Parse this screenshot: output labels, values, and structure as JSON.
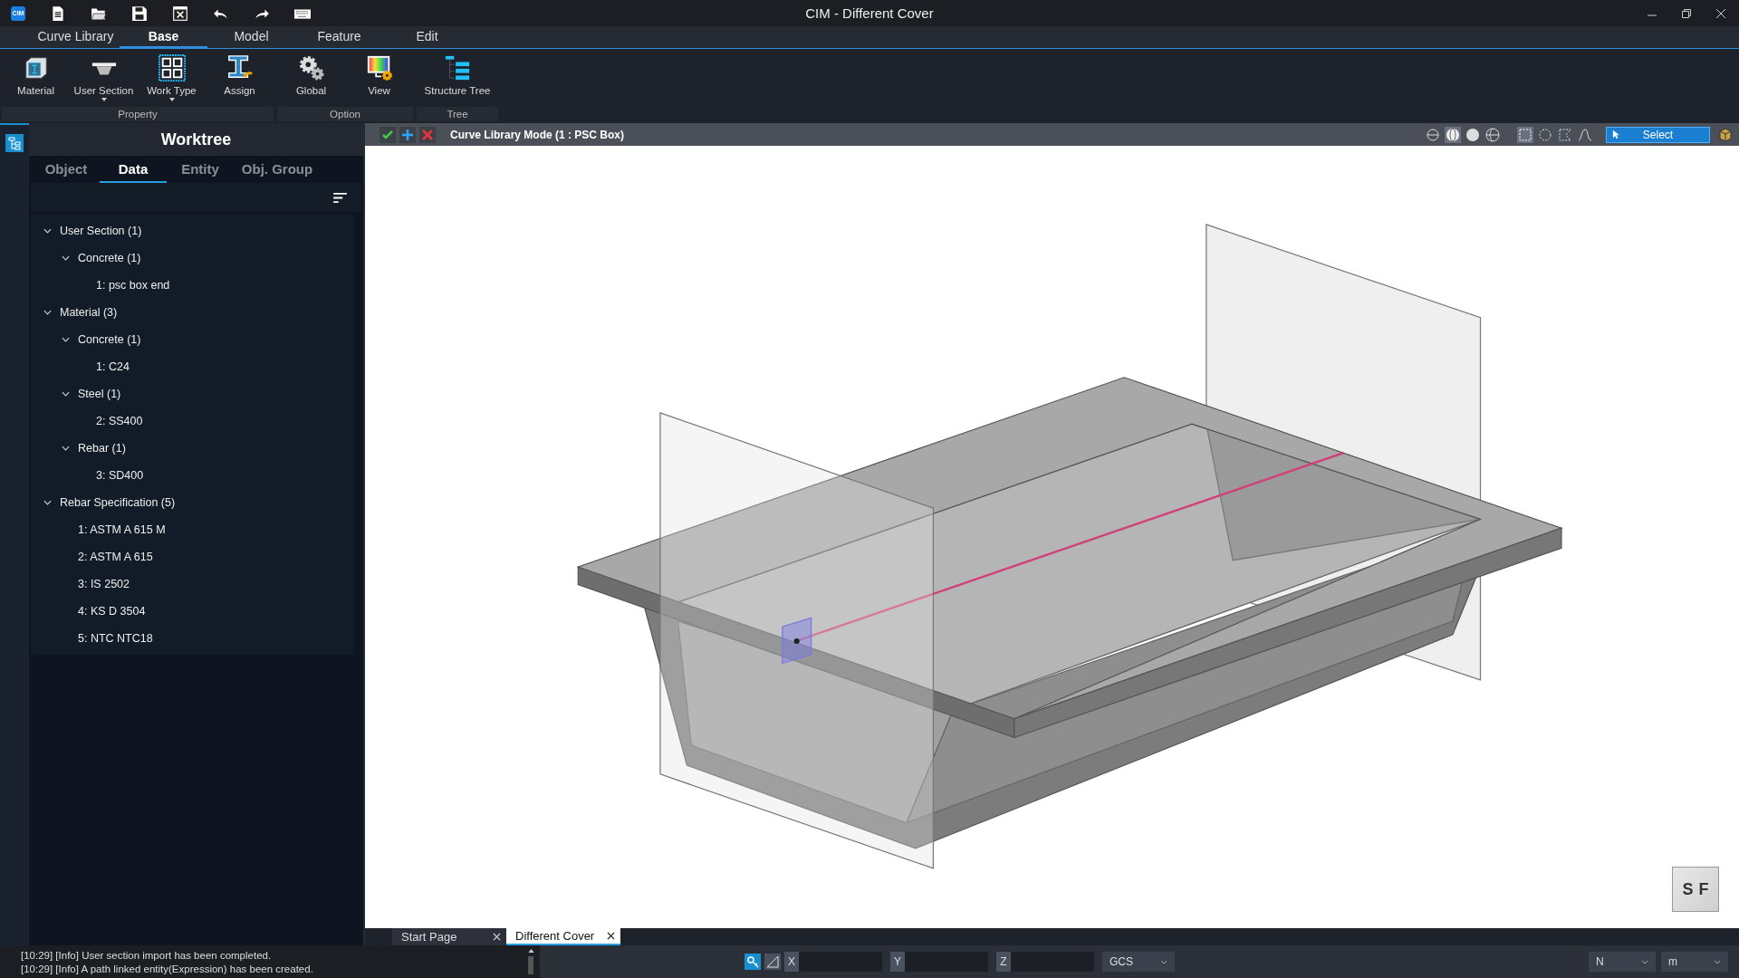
{
  "window": {
    "app_logo": "CIM",
    "title": "CIM - Different Cover"
  },
  "ribbon": {
    "tabs": [
      {
        "label": "Curve Library",
        "selected": false
      },
      {
        "label": "Base",
        "selected": true
      },
      {
        "label": "Model",
        "selected": false
      },
      {
        "label": "Feature",
        "selected": false
      },
      {
        "label": "Edit",
        "selected": false
      }
    ],
    "groups": [
      {
        "label": "Property",
        "buttons": [
          {
            "label": "Material",
            "kind": "material",
            "dropdown": false
          },
          {
            "label": "User Section",
            "kind": "section",
            "dropdown": true
          },
          {
            "label": "Work Type",
            "kind": "worktype",
            "dropdown": true
          },
          {
            "label": "Assign",
            "kind": "assign",
            "dropdown": false
          }
        ]
      },
      {
        "label": "Option",
        "buttons": [
          {
            "label": "Global",
            "kind": "gears",
            "dropdown": false
          },
          {
            "label": "View",
            "kind": "view",
            "dropdown": false
          }
        ]
      },
      {
        "label": "Tree",
        "buttons": [
          {
            "label": "Structure Tree",
            "kind": "tree",
            "dropdown": false
          }
        ]
      }
    ]
  },
  "worktree": {
    "title": "Worktree",
    "tabs": [
      {
        "label": "Object",
        "selected": false
      },
      {
        "label": "Data",
        "selected": true
      },
      {
        "label": "Entity",
        "selected": false
      },
      {
        "label": "Obj. Group",
        "selected": false
      }
    ],
    "tree": [
      {
        "label": "User Section (1)",
        "expanded": true,
        "children": [
          {
            "label": "Concrete (1)",
            "expanded": true,
            "children": [
              {
                "label": "1: psc box end"
              }
            ]
          }
        ]
      },
      {
        "label": "Material (3)",
        "expanded": true,
        "children": [
          {
            "label": "Concrete (1)",
            "expanded": true,
            "children": [
              {
                "label": "1: C24"
              }
            ]
          },
          {
            "label": "Steel (1)",
            "expanded": true,
            "children": [
              {
                "label": "2: SS400"
              }
            ]
          },
          {
            "label": "Rebar (1)",
            "expanded": true,
            "children": [
              {
                "label": "3: SD400"
              }
            ]
          }
        ]
      },
      {
        "label": "Rebar Specification (5)",
        "expanded": true,
        "children": [
          {
            "label": "1: ASTM A 615 M"
          },
          {
            "label": "2: ASTM A 615"
          },
          {
            "label": "3: IS 2502"
          },
          {
            "label": "4: KS D 3504"
          },
          {
            "label": "5: NTC NTC18"
          }
        ]
      }
    ]
  },
  "viewport": {
    "mode_title": "Curve Library Mode (1 : PSC Box)",
    "select_button": "Select",
    "viewcube": [
      "S",
      "F"
    ]
  },
  "document_tabs": [
    {
      "label": "Start Page",
      "selected": false
    },
    {
      "label": "Different Cover",
      "selected": true
    }
  ],
  "log": [
    "[10:29] [Info] User section import has been completed.",
    "[10:29] [Info] A path linked entity(Expression) has been created."
  ],
  "coordinates": {
    "fields": [
      {
        "label": "X"
      },
      {
        "label": "Y"
      },
      {
        "label": "Z"
      }
    ],
    "system": "GCS",
    "force_unit": "N",
    "length_unit": "m"
  }
}
